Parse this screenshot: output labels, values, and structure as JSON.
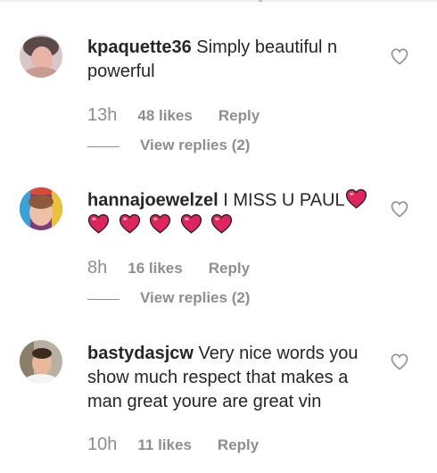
{
  "comments": [
    {
      "username": "kpaquette36",
      "text": "Simply beautiful n powerful",
      "time": "13h",
      "likes": "48 likes",
      "reply_label": "Reply",
      "view_replies": "View replies (2)",
      "avatar_icon": "user-avatar"
    },
    {
      "username": "hannajoewelzel",
      "text": "I MISS U PAUL",
      "heart_emoji_count": 6,
      "time": "8h",
      "likes": "16 likes",
      "reply_label": "Reply",
      "view_replies": "View replies (2)",
      "avatar_icon": "user-avatar"
    },
    {
      "username": "bastydasjcw",
      "text": "Very nice words you show much respect that makes a man great youre are great vin",
      "time": "10h",
      "likes": "11 likes",
      "reply_label": "Reply",
      "avatar_icon": "user-avatar"
    }
  ],
  "colors": {
    "text": "#262626",
    "muted": "#8e8e8e",
    "heart_emoji": "#e0245e"
  },
  "icons": {
    "like": "heart-outline-icon",
    "emoji": "red-heart-emoji"
  }
}
